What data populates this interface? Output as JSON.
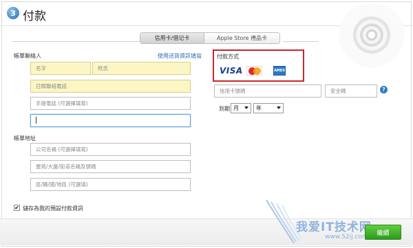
{
  "header": {
    "step_number": "3",
    "title": "付款"
  },
  "tabs": [
    {
      "label": "信用卡/借记卡",
      "active": true
    },
    {
      "label": "Apple Store 禮品卡",
      "active": false
    }
  ],
  "contact": {
    "section_label": "帳單聯絡人",
    "link_text": "使用送貨資訊填寫",
    "fields": {
      "first_name": "名字",
      "last_name": "姓氏",
      "day_phone": "日間聯絡電話",
      "mobile_phone": "手提電話 (可選擇填寫)",
      "email": ""
    }
  },
  "address": {
    "section_label": "帳單地址",
    "fields": {
      "company": "公司名稱 (可選擇填寫)",
      "street": "屋苑/大廈/街道名稱及號碼",
      "district": "區/縣/國/地區 (可選填)"
    }
  },
  "payment": {
    "section_label": "付款方式",
    "cards": [
      {
        "name": "visa-icon",
        "label": "VISA"
      },
      {
        "name": "mastercard-icon",
        "label": ""
      },
      {
        "name": "amex-icon",
        "label": "AMEX"
      }
    ],
    "card_number_placeholder": "信用卡號碼",
    "security_code_placeholder": "安全碼",
    "help_glyph": "?",
    "expiry_label": "到期",
    "month_value": "月",
    "year_value": "年"
  },
  "save": {
    "checked": true,
    "label": "儲存為我的預設付款資訊"
  },
  "footer": {
    "continue_label": "繼續"
  },
  "watermark": {
    "text": "我爱IT技术网",
    "url": "www.52ij.com"
  },
  "colors": {
    "accent_blue": "#2a6db3",
    "highlight_border": "#c8262a",
    "continue_green": "#3ab52a",
    "yellow_field": "#fbf6c4"
  }
}
